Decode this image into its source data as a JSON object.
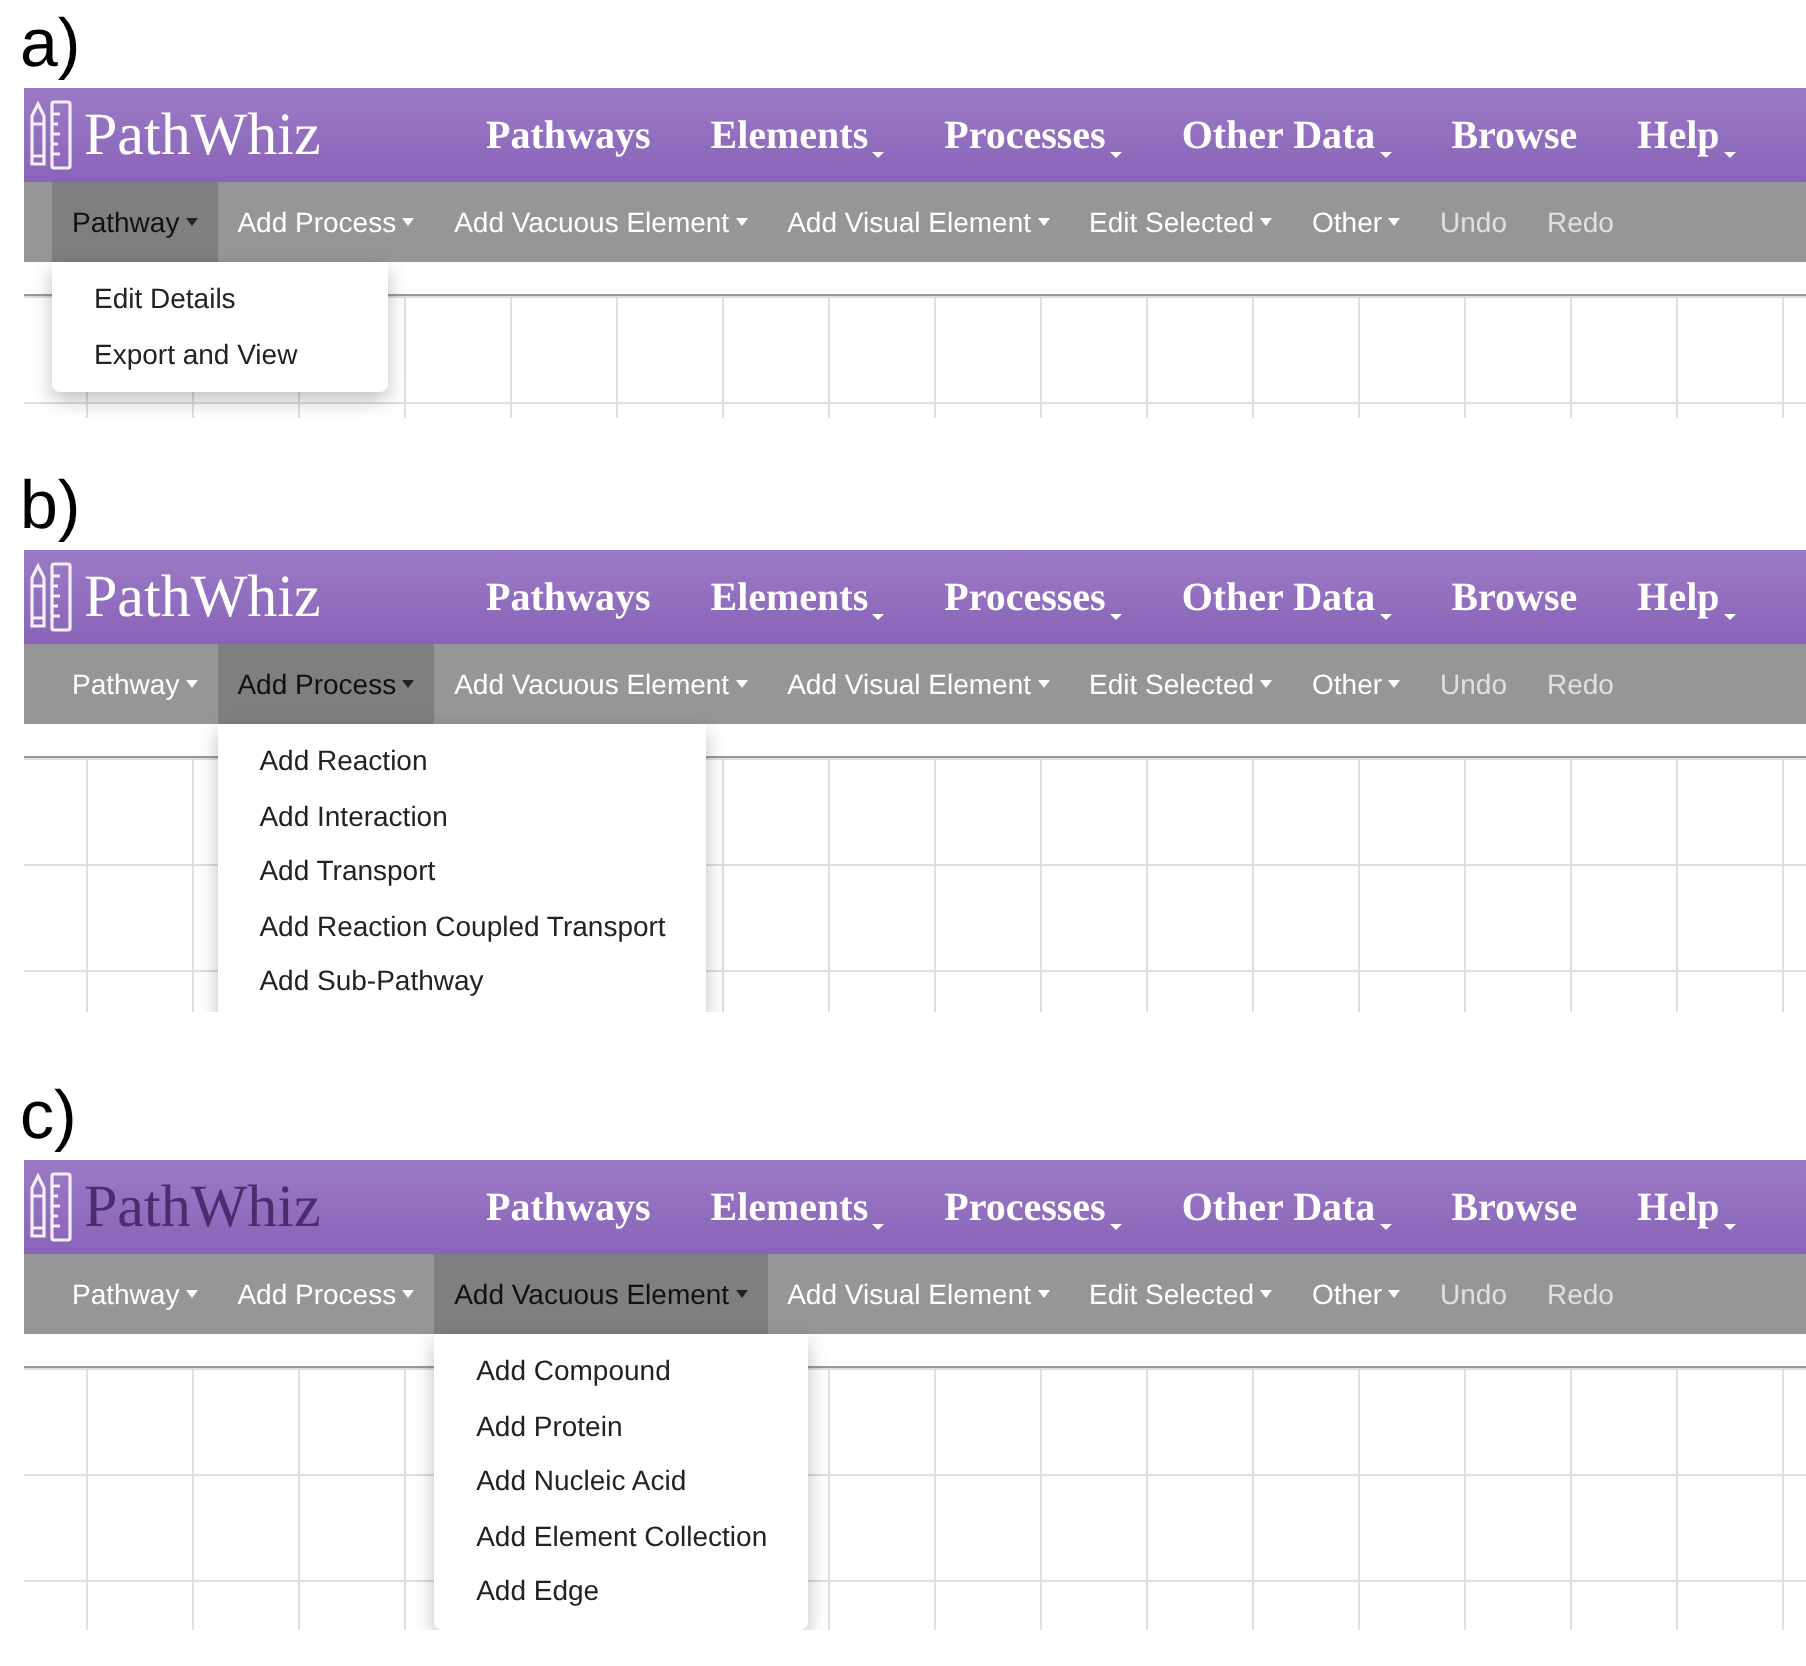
{
  "panels": [
    {
      "label": "a)",
      "logo": {
        "text": "PathWhiz",
        "hovered": false
      },
      "nav": [
        {
          "label": "Pathways",
          "has_menu": false
        },
        {
          "label": "Elements",
          "has_menu": true
        },
        {
          "label": "Processes",
          "has_menu": true
        },
        {
          "label": "Other Data",
          "has_menu": true
        },
        {
          "label": "Browse",
          "has_menu": false
        },
        {
          "label": "Help",
          "has_menu": true
        }
      ],
      "toolbar": [
        {
          "label": "Pathway",
          "has_menu": true,
          "disabled": false,
          "selected": true
        },
        {
          "label": "Add Process",
          "has_menu": true,
          "disabled": false,
          "selected": false
        },
        {
          "label": "Add Vacuous Element",
          "has_menu": true,
          "disabled": false,
          "selected": false
        },
        {
          "label": "Add Visual Element",
          "has_menu": true,
          "disabled": false,
          "selected": false
        },
        {
          "label": "Edit Selected",
          "has_menu": true,
          "disabled": false,
          "selected": false
        },
        {
          "label": "Other",
          "has_menu": true,
          "disabled": false,
          "selected": false
        },
        {
          "label": "Undo",
          "has_menu": false,
          "disabled": true,
          "selected": false
        },
        {
          "label": "Redo",
          "has_menu": false,
          "disabled": true,
          "selected": false
        }
      ],
      "dropdown": [
        "Edit Details",
        "Export and View"
      ]
    },
    {
      "label": "b)",
      "logo": {
        "text": "PathWhiz",
        "hovered": false
      },
      "nav": [
        {
          "label": "Pathways",
          "has_menu": false
        },
        {
          "label": "Elements",
          "has_menu": true
        },
        {
          "label": "Processes",
          "has_menu": true
        },
        {
          "label": "Other Data",
          "has_menu": true
        },
        {
          "label": "Browse",
          "has_menu": false
        },
        {
          "label": "Help",
          "has_menu": true
        }
      ],
      "toolbar": [
        {
          "label": "Pathway",
          "has_menu": true,
          "disabled": false,
          "selected": false
        },
        {
          "label": "Add Process",
          "has_menu": true,
          "disabled": false,
          "selected": true
        },
        {
          "label": "Add Vacuous Element",
          "has_menu": true,
          "disabled": false,
          "selected": false
        },
        {
          "label": "Add Visual Element",
          "has_menu": true,
          "disabled": false,
          "selected": false
        },
        {
          "label": "Edit Selected",
          "has_menu": true,
          "disabled": false,
          "selected": false
        },
        {
          "label": "Other",
          "has_menu": true,
          "disabled": false,
          "selected": false
        },
        {
          "label": "Undo",
          "has_menu": false,
          "disabled": true,
          "selected": false
        },
        {
          "label": "Redo",
          "has_menu": false,
          "disabled": true,
          "selected": false
        }
      ],
      "dropdown": [
        "Add Reaction",
        "Add Interaction",
        "Add Transport",
        "Add Reaction Coupled Transport",
        "Add Sub-Pathway"
      ]
    },
    {
      "label": "c)",
      "logo": {
        "text": "PathWhiz",
        "hovered": true
      },
      "nav": [
        {
          "label": "Pathways",
          "has_menu": false
        },
        {
          "label": "Elements",
          "has_menu": true
        },
        {
          "label": "Processes",
          "has_menu": true
        },
        {
          "label": "Other Data",
          "has_menu": true
        },
        {
          "label": "Browse",
          "has_menu": false
        },
        {
          "label": "Help",
          "has_menu": true
        }
      ],
      "toolbar": [
        {
          "label": "Pathway",
          "has_menu": true,
          "disabled": false,
          "selected": false
        },
        {
          "label": "Add Process",
          "has_menu": true,
          "disabled": false,
          "selected": false
        },
        {
          "label": "Add Vacuous Element",
          "has_menu": true,
          "disabled": false,
          "selected": true
        },
        {
          "label": "Add Visual Element",
          "has_menu": true,
          "disabled": false,
          "selected": false
        },
        {
          "label": "Edit Selected",
          "has_menu": true,
          "disabled": false,
          "selected": false
        },
        {
          "label": "Other",
          "has_menu": true,
          "disabled": false,
          "selected": false
        },
        {
          "label": "Undo",
          "has_menu": false,
          "disabled": true,
          "selected": false
        },
        {
          "label": "Redo",
          "has_menu": false,
          "disabled": true,
          "selected": false
        }
      ],
      "dropdown": [
        "Add Compound",
        "Add Protein",
        "Add Nucleic Acid",
        "Add Element Collection",
        "Add Edge"
      ]
    }
  ]
}
